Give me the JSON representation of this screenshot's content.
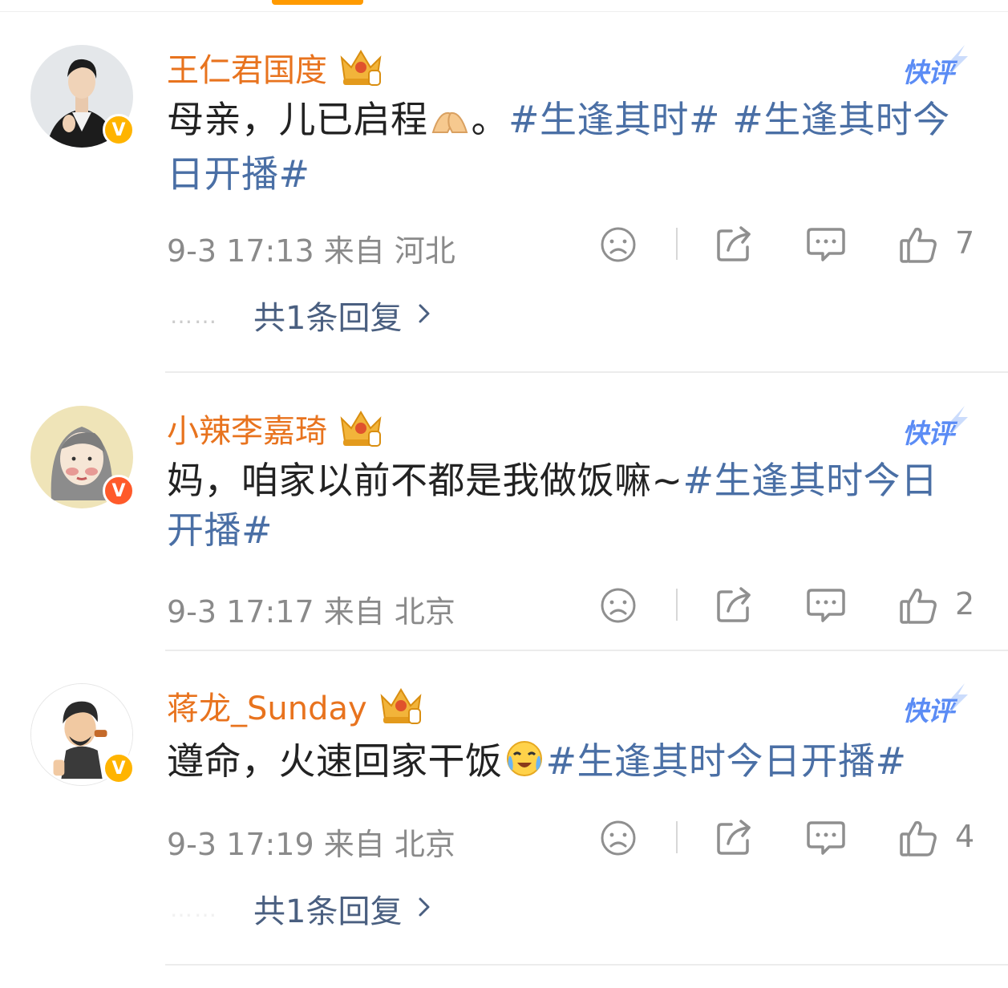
{
  "comments": [
    {
      "username": "王仁君国度",
      "badge_color": "#ffb400",
      "avatar_bg": "#dfe3e6",
      "content_prefix": "母亲，儿已启程",
      "content_mid": "。",
      "topic1": "#生逢其时#",
      "topic2": "#生逢其时今日开播#",
      "time": "9-3 17:13",
      "location": "来自 河北",
      "likes": "7",
      "reply_link": "共1条回复",
      "quick_comment": "快评"
    },
    {
      "username": "小辣李嘉琦",
      "badge_color": "#ff5a2a",
      "avatar_bg": "#efe4b8",
      "content_prefix": "妈，咱家以前不都是我做饭嘛~",
      "topic1": "#生逢其时今日开播#",
      "time": "9-3 17:17",
      "location": "来自 北京",
      "likes": "2",
      "quick_comment": "快评"
    },
    {
      "username": "蒋龙_Sunday",
      "badge_color": "#ffb400",
      "avatar_bg": "#ffffff",
      "content_prefix": "遵命，火速回家干饭",
      "topic1": "#生逢其时今日开播#",
      "time": "9-3 17:19",
      "location": "来自 北京",
      "likes": "4",
      "reply_link": "共1条回复",
      "quick_comment": "快评"
    }
  ],
  "icons": {
    "verified": "V",
    "dislike": "sad-face-icon",
    "share": "share-icon",
    "comment": "comment-icon",
    "like": "thumbs-up-icon",
    "more_replies": "chevron-right-icon"
  },
  "accent_colors": {
    "username": "#e8731e",
    "topic": "#4a6fa5",
    "quick_comment": "#5b8cf5",
    "tab": "#ff9a00"
  }
}
